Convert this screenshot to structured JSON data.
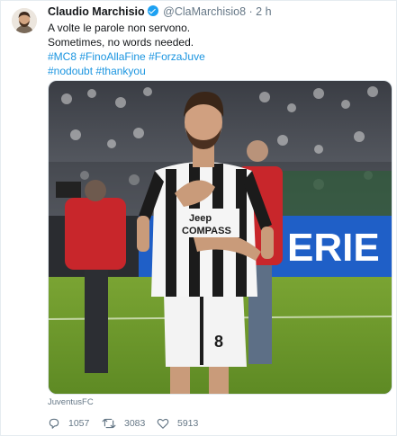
{
  "tweet": {
    "author_name": "Claudio Marchisio",
    "handle": "@ClaMarchisio8",
    "separator": "·",
    "time": "2 h",
    "lines": [
      {
        "text": "A volte le parole non servono."
      },
      {
        "text": "Sometimes, no words needed."
      },
      {
        "tags": [
          "#MC8",
          "#FinoAllaFine",
          "#ForzaJuve"
        ]
      },
      {
        "tags": [
          "#nodoubt",
          "#thankyou"
        ]
      }
    ],
    "photo": {
      "banner_text": "ERIE",
      "shirt_text_1": "Jeep",
      "shirt_text_2": "COMPASS",
      "shorts_number": "8"
    },
    "attribution": "JuventusFC",
    "actions": {
      "reply_count": "1057",
      "retweet_count": "3083",
      "like_count": "5913"
    }
  },
  "colors": {
    "link": "#1b95e0",
    "muted": "#657786",
    "verified": "#1da1f2",
    "pitch": "#6f9a2e",
    "banner_blue": "#1f5fc7"
  },
  "icons": [
    "avatar",
    "verified-badge-icon",
    "reply-icon",
    "retweet-icon",
    "like-icon"
  ]
}
